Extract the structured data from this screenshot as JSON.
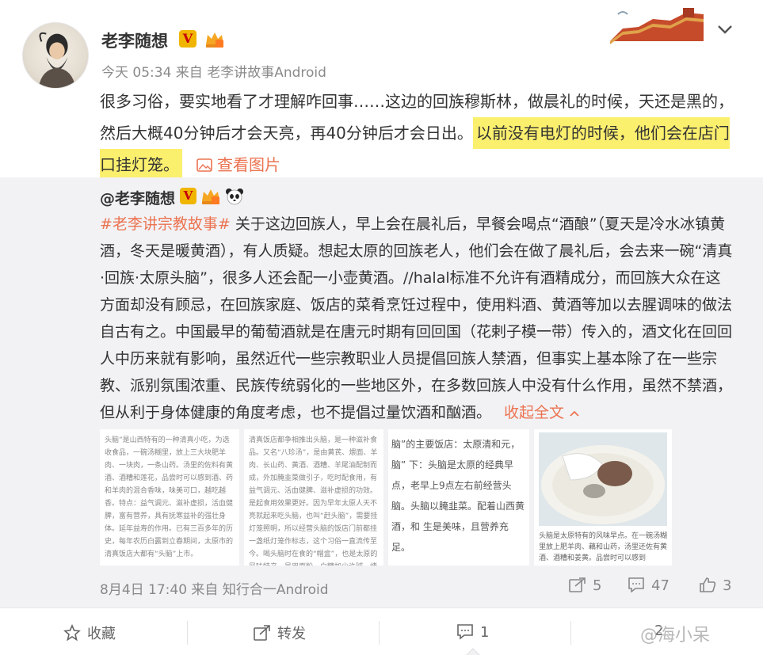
{
  "post": {
    "username": "老李随想",
    "verified_badge": "V",
    "meta": "今天 05:34 来自 老李讲故事Android",
    "text_plain": "很多习俗，要实地看了才理解咋回事……这边的回族穆斯林，做晨礼的时候，天还是黑的，然后大概40分钟后才会天亮，再40分钟后才会日出。",
    "text_highlight": "以前没有电灯的时候，他们会在店门口挂灯笼。",
    "view_picture": "查看图片"
  },
  "repost": {
    "username": "@老李随想",
    "verified_badge": "V",
    "hashtag": "#老李讲宗教故事#",
    "text": " 关于这边回族人，早上会在晨礼后，早餐会喝点“酒酿”（夏天是冷水冰镇黄酒，冬天是暖黄酒），有人质疑。想起太原的回族老人，他们会在做了晨礼后，会去来一碗“清真·回族·太原头脑”，很多人还会配一小壶黄酒。//halal标准不允许有酒精成分，而回族大众在这方面却没有顾忌，在回族家庭、饭店的菜肴烹饪过程中，使用料酒、黄酒等加以去腥调味的做法自古有之。中国最早的葡萄酒就是在唐元时期有回回国（花剌子模一带）传入的，酒文化在回回人中历来就有影响，虽然近代一些宗教职业人员提倡回族人禁酒，但事实上基本除了在一些宗教、派别氛围浓重、民族传统弱化的一些地区外，在多数回族人中没有什么作用，虽然不禁酒，但从利于身体健康的角度考虑，也不提倡过量饮酒和酗酒。",
    "collapse": "收起全文",
    "thumb1_text": "头脑”是山西特有的一种清真小吃，为选收食品，一碗汤糊里，放上三大块肥羊肉、一块肉，一条山药。汤里的佐料有黄酒、酒糟和莲花，品尝时可以感到酒、药和羊肉的混合香味，味美可口，越吃越香。特点：益气调元、滋补虚损，活血健脾，富有营养，具有抚寒益补的强壮身体。延年益寿的作用。已有三百多年的历史，每年农历白露到立春期间，太原市的清真饭店大都有“头脑”上市。",
    "thumb2_text": "清真饭店都争相推出头脑，是一种滋补食品。又名“八珍汤”，是由黄芪、煨面、羊肉、长山药、黄酒、酒糟、羊尾油配制而成，外加腌韭菜做引子，吃时配食用，有益气调元、活血健脾、滋补虚损的功效。是起食用效果更好。因为早年太原人天不亮就起来吃头脑，也叫“赶头脑”，需要挂灯笼照明，所以经营头脑的饭店门前都挂一盏纸灯笼作标志，这个习俗一直流传至今。喝头脑时在食的“帽盒”，也是太原的风味特产，是用面粉、白糖加少许碱，烤成两片空壳，合在一起，入炉烤制。",
    "thumb3_text": "脑”的主要饭店：太原清和元，脑” 下：头脑是太原的经典早点，老早上9点左右前经营头脑。头脑以腌韭菜。配着山西黄酒，和 生是美味，且营养充足。",
    "thumb4_caption": "头脑是太原特有的风味早点。在一碗汤糊里放上肥羊肉、藕和山药，汤里还佐有黄酒、酒糟和姜黄。品尝时可以感到",
    "meta": "8月4日 17:40 来自 知行合一Android",
    "shares": "5",
    "comments": "47",
    "likes": "3"
  },
  "bottom_bar": {
    "favorite": "收藏",
    "forward": "转发",
    "comment": "1",
    "like": "2"
  },
  "watermark": "@海小呆",
  "colors": {
    "accent": "#eb7350",
    "highlight": "#fbef6e",
    "repost_bg": "#f2f2f5",
    "verified": "#f0b500"
  }
}
